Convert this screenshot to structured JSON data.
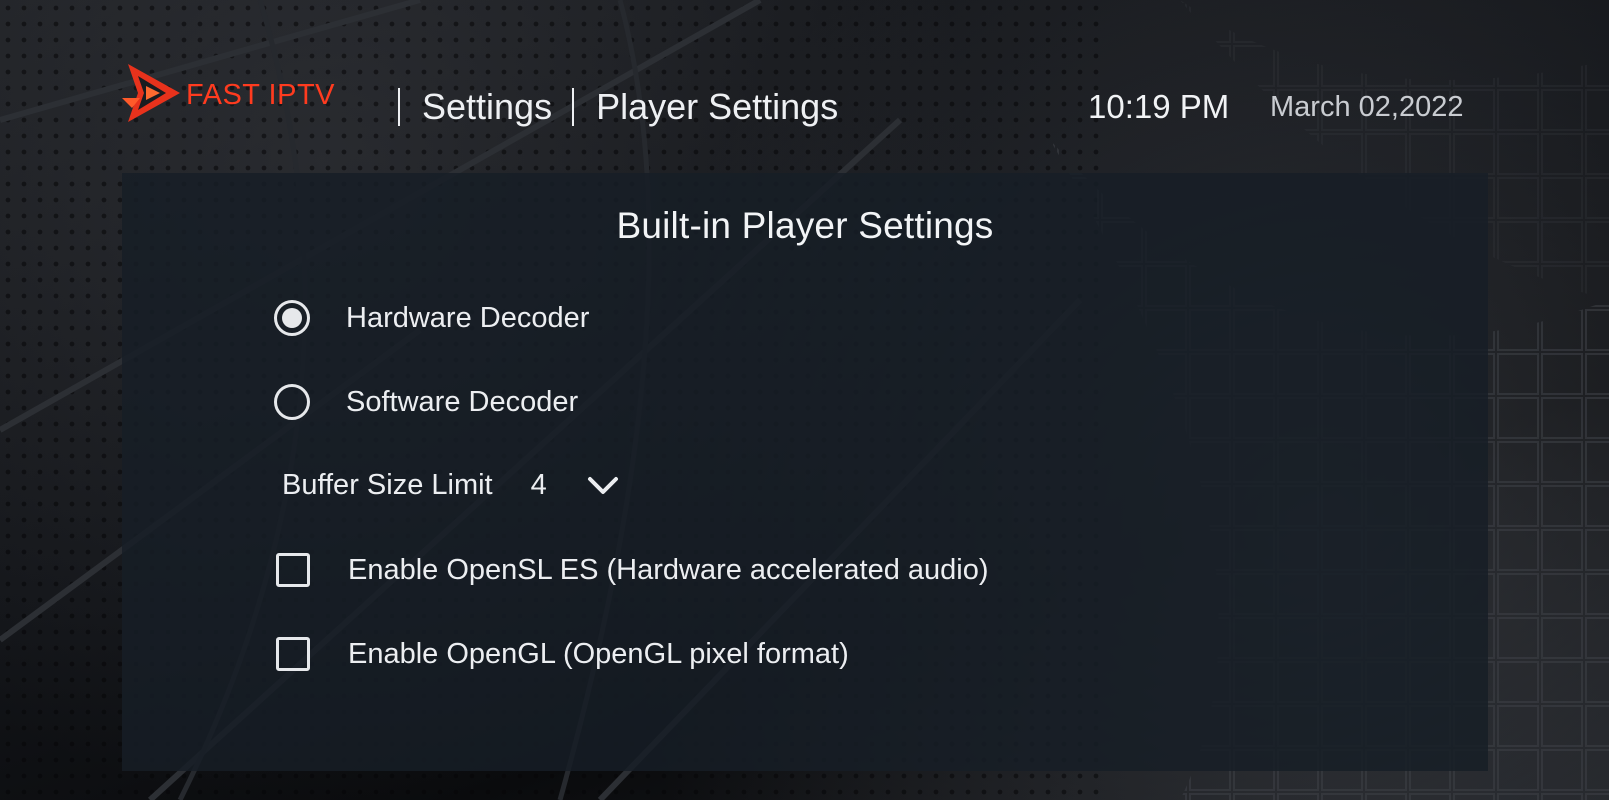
{
  "header": {
    "brand": "FAST IPTV",
    "breadcrumb": {
      "section": "Settings",
      "page": "Player Settings"
    },
    "time": "10:19 PM",
    "date": "March 02,2022"
  },
  "panel": {
    "title": "Built-in Player Settings",
    "decoder_options": [
      {
        "label": "Hardware Decoder",
        "selected": true
      },
      {
        "label": "Software Decoder",
        "selected": false
      }
    ],
    "buffer": {
      "label": "Buffer Size Limit",
      "value": "4"
    },
    "checkboxes": [
      {
        "label": "Enable OpenSL ES (Hardware accelerated audio)",
        "checked": false
      },
      {
        "label": "Enable OpenGL (OpenGL pixel format)",
        "checked": false
      }
    ]
  },
  "colors": {
    "brand_accent": "#ff3b1f",
    "panel_background": "#171e26",
    "text_primary": "#eceef1"
  },
  "icons": {
    "logo": "play-triangle-logo-icon",
    "dropdown": "chevron-down-icon"
  }
}
